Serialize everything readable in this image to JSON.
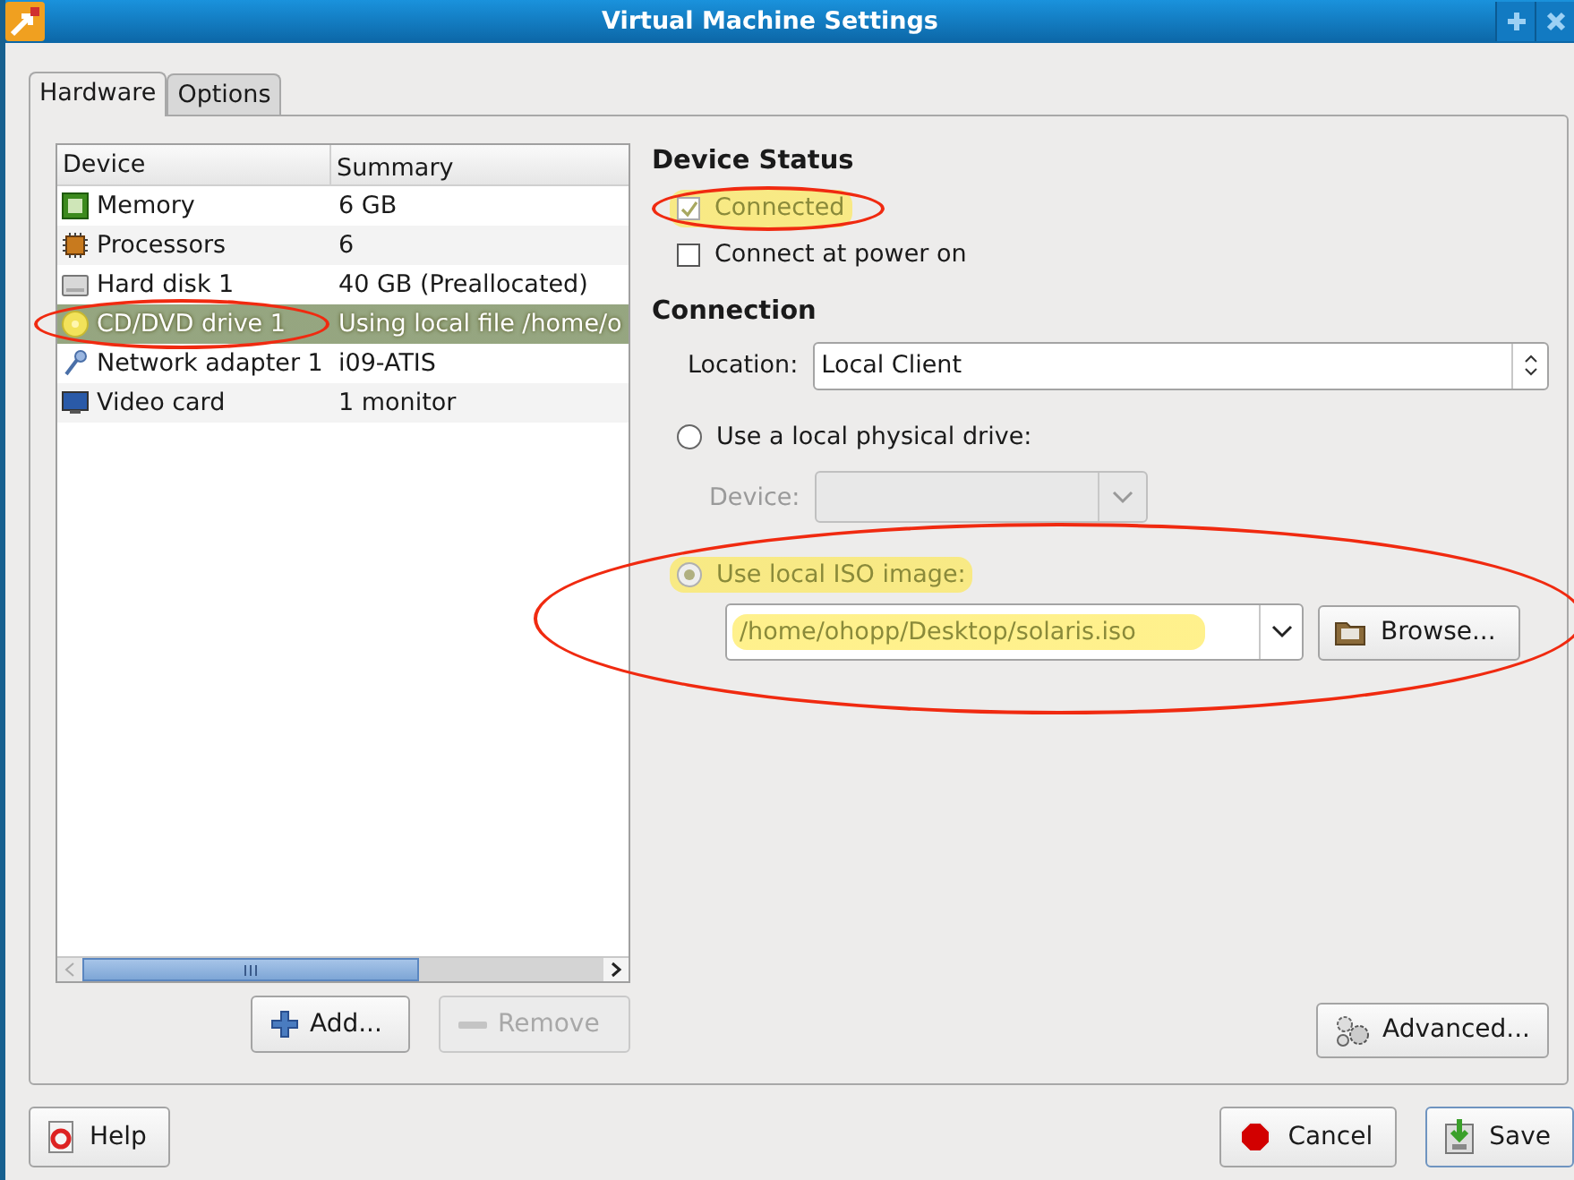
{
  "window": {
    "title": "Virtual Machine Settings"
  },
  "tabs": [
    {
      "label": "Hardware",
      "selected": true
    },
    {
      "label": "Options",
      "selected": false
    }
  ],
  "device_table": {
    "columns": [
      "Device",
      "Summary"
    ],
    "rows": [
      {
        "kind": "memory",
        "device": "Memory",
        "summary": "6 GB",
        "selected": false,
        "highlighted": false,
        "circled": false
      },
      {
        "kind": "processor",
        "device": "Processors",
        "summary": "6",
        "selected": false,
        "highlighted": false,
        "circled": false
      },
      {
        "kind": "disk",
        "device": "Hard disk 1",
        "summary": "40 GB (Preallocated)",
        "selected": false,
        "highlighted": false,
        "circled": false
      },
      {
        "kind": "cdrom",
        "device": "CD/DVD drive 1",
        "summary": "Using local file /home/o",
        "selected": true,
        "highlighted": true,
        "circled": true
      },
      {
        "kind": "network",
        "device": "Network adapter 1",
        "summary": "i09-ATIS",
        "selected": false,
        "highlighted": false,
        "circled": false
      },
      {
        "kind": "display",
        "device": "Video card",
        "summary": "1 monitor",
        "selected": false,
        "highlighted": false,
        "circled": false
      }
    ]
  },
  "device_buttons": [
    {
      "kind": "add",
      "label": "Add...",
      "disabled": false
    },
    {
      "kind": "remove",
      "label": "Remove",
      "disabled": true
    }
  ],
  "device_status": {
    "heading": "Device Status",
    "checkboxes": [
      {
        "label": "Connected",
        "checked": true,
        "disabled": true,
        "highlighted": true,
        "circled": true
      },
      {
        "label": "Connect at power on",
        "checked": false,
        "disabled": false,
        "highlighted": false,
        "circled": false
      }
    ]
  },
  "connection": {
    "heading": "Connection",
    "location_label": "Location:",
    "location_value": "Local Client",
    "options": [
      {
        "kind": "physical",
        "label": "Use a local physical drive:",
        "selected": false,
        "disabled": false,
        "highlighted": false,
        "circled": false,
        "device_label": "Device:",
        "device_disabled": true
      },
      {
        "kind": "iso",
        "label": "Use local ISO image:",
        "selected": true,
        "disabled": true,
        "highlighted": true,
        "circled": true,
        "path": "/home/ohopp/Desktop/solaris.iso",
        "path_highlighted": true,
        "browse": "Browse..."
      }
    ]
  },
  "advanced_button": "Advanced...",
  "footer_buttons": [
    {
      "kind": "help",
      "label": "Help",
      "default": false
    },
    {
      "kind": "cancel",
      "label": "Cancel",
      "default": false
    },
    {
      "kind": "save",
      "label": "Save",
      "default": true
    }
  ]
}
